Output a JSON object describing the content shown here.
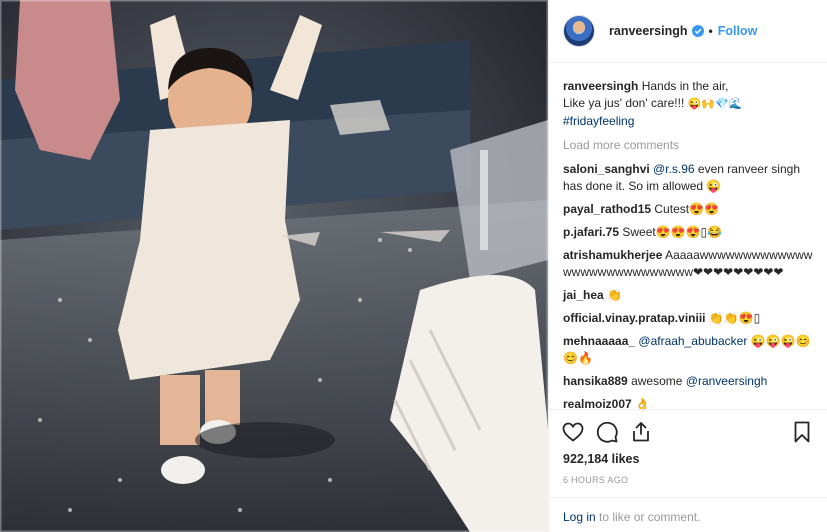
{
  "post": {
    "username": "ranveersingh",
    "follow_label": "Follow",
    "separator": "•",
    "caption_user": "ranveersingh",
    "caption_line1": "Hands in the air,",
    "caption_line2": "Like ya jus' don' care!!!",
    "caption_emoji": "😜🙌💎🌊",
    "hashtag": "#fridayfeeling",
    "load_more": "Load more comments"
  },
  "comments": [
    {
      "user": "saloni_sanghvi",
      "mention": "@r.s.96",
      "text": "even ranveer singh has done it. So im allowed 😜"
    },
    {
      "user": "payal_rathod15",
      "mention": "",
      "text": "Cutest😍😍"
    },
    {
      "user": "p.jafari.75",
      "mention": "",
      "text": "Sweet😍😍😍▯😂"
    },
    {
      "user": "atrishamukherjee",
      "mention": "",
      "text": "Aaaaawwwwwwwwwwwwwwwwwwwwwwwwwwww❤❤❤❤❤❤❤❤❤"
    },
    {
      "user": "jai_hea",
      "mention": "",
      "text": "👏"
    },
    {
      "user": "official.vinay.pratap.viniii",
      "mention": "",
      "text": "👏👏😍▯"
    },
    {
      "user": "mehnaaaaa_",
      "mention": "@afraah_abubacker",
      "text": "😜😜😜😊😊🔥"
    },
    {
      "user": "hansika889",
      "mention": "@ranveersingh",
      "text": "awesome"
    },
    {
      "user": "realmoiz007",
      "mention": "",
      "text": "👌"
    }
  ],
  "stats": {
    "likes": "922,184 likes",
    "time": "6 HOURS AGO"
  },
  "footer": {
    "login": "Log in",
    "rest": " to like or comment."
  },
  "icons": [
    "heart-icon",
    "comment-icon",
    "share-icon",
    "bookmark-icon",
    "verified-icon"
  ],
  "colors": {
    "link": "#3897f0",
    "mention": "#003569",
    "muted": "#999999",
    "verified": "#3897f0"
  }
}
